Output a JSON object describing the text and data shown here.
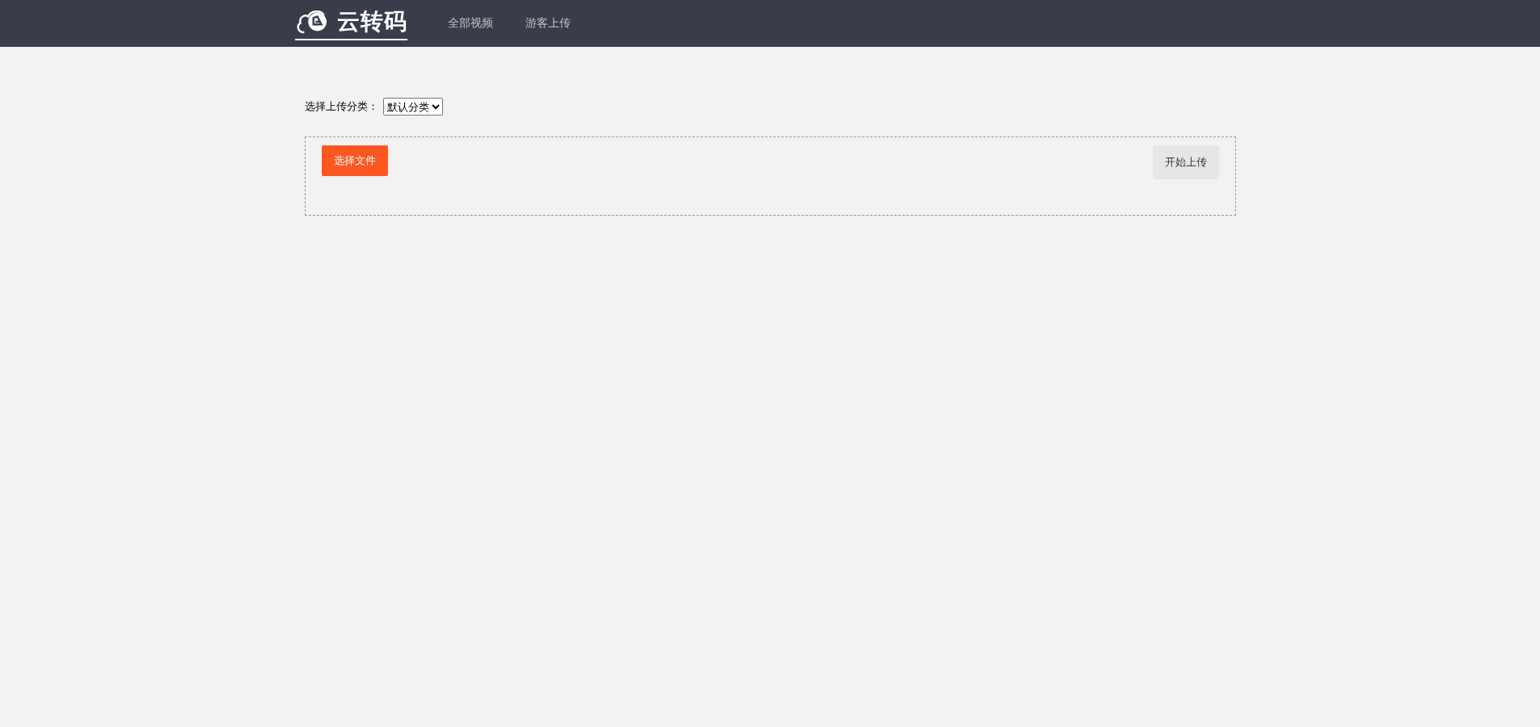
{
  "header": {
    "logo": {
      "text": "云转码"
    },
    "nav": [
      {
        "label": "全部视频",
        "selected": false
      },
      {
        "label": "游客上传",
        "selected": false
      }
    ]
  },
  "upload": {
    "category": {
      "label": "选择上传分类：",
      "value": "默认分类"
    },
    "choose_button": "选择文件",
    "start_button": "开始上传"
  }
}
